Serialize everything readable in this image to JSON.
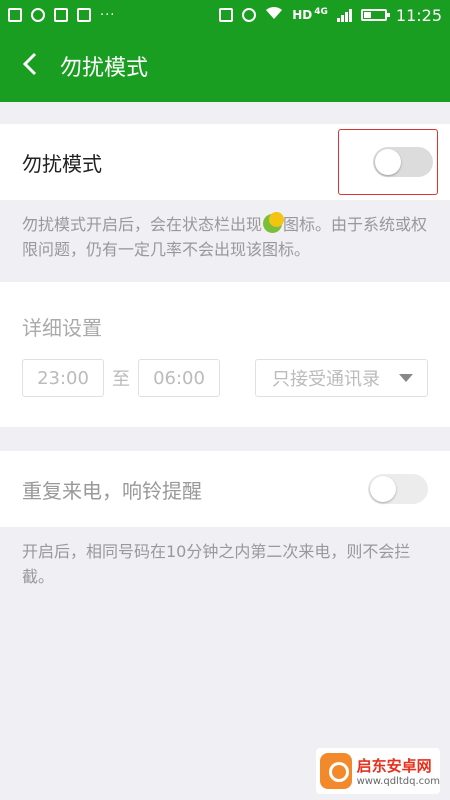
{
  "status_bar": {
    "more_label": "···",
    "hd_label": "HD",
    "net_label": "4G",
    "time": "11:25"
  },
  "app_bar": {
    "back_icon": "chevron-left-icon",
    "title": "勿扰模式"
  },
  "dnd": {
    "label": "勿扰模式",
    "enabled": false,
    "hint_part1": "勿扰模式开启后，会在状态栏出现",
    "hint_icon": "moon-icon",
    "hint_part2": "图标。由于系统或权限问题，仍有一定几率不会出现该图标。"
  },
  "detail": {
    "title": "详细设置",
    "start_time": "23:00",
    "to_label": "至",
    "end_time": "06:00",
    "filter_value": "只接受通讯录"
  },
  "repeat_call": {
    "label": "重复来电，响铃提醒",
    "enabled": false,
    "hint": "开启后，相同号码在10分钟之内第二次来电，则不会拦截。"
  },
  "watermark": {
    "name": "启东安卓网",
    "url": "www.qdltdq.com"
  },
  "colors": {
    "accent": "#1a9e21",
    "toggle_off": "#dcdcdc",
    "highlight_frame": "#dd3333"
  }
}
